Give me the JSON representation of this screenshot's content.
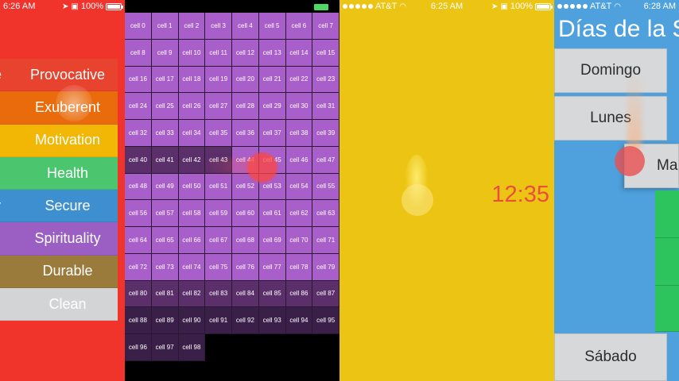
{
  "panel1": {
    "status": {
      "time": "6:26 AM",
      "battery": "100%"
    },
    "moods": [
      {
        "label": "Provocative",
        "color": "#e8432e",
        "clip": "e"
      },
      {
        "label": "Exuberent",
        "color": "#e96b0c",
        "clip": ""
      },
      {
        "label": "Motivation",
        "color": "#f2b705",
        "clip": ""
      },
      {
        "label": "Health",
        "color": "#4bc66f",
        "clip": ""
      },
      {
        "label": "Secure",
        "color": "#3d8fd0",
        "clip": "y"
      },
      {
        "label": "Spirituality",
        "color": "#9b5fc4",
        "clip": ""
      },
      {
        "label": "Durable",
        "color": "#9a7b3c",
        "clip": ""
      },
      {
        "label": "Clean",
        "color": "#d3d4d6",
        "clip": ""
      }
    ]
  },
  "panel2": {
    "cells": [
      "cell 0",
      "cell 1",
      "cell 2",
      "cell 3",
      "cell 4",
      "cell 5",
      "cell 6",
      "cell 7",
      "cell 8",
      "cell 9",
      "cell 10",
      "cell 11",
      "cell 12",
      "cell 13",
      "cell 14",
      "cell 15",
      "cell 16",
      "cell 17",
      "cell 18",
      "cell 19",
      "cell 20",
      "cell 21",
      "cell 22",
      "cell 23",
      "cell 24",
      "cell 25",
      "cell 26",
      "cell 27",
      "cell 28",
      "cell 29",
      "cell 30",
      "cell 31",
      "cell 32",
      "cell 33",
      "cell 34",
      "cell 35",
      "cell 36",
      "cell 37",
      "cell 38",
      "cell 39",
      "cell 40",
      "cell 41",
      "cell 42",
      "cell 43",
      "cell 44",
      "cell 45",
      "cell 46",
      "cell 47",
      "cell 48",
      "cell 49",
      "cell 50",
      "cell 51",
      "cell 52",
      "cell 53",
      "cell 54",
      "cell 55",
      "cell 56",
      "cell 57",
      "cell 58",
      "cell 59",
      "cell 60",
      "cell 61",
      "cell 62",
      "cell 63",
      "cell 64",
      "cell 65",
      "cell 66",
      "cell 67",
      "cell 68",
      "cell 69",
      "cell 70",
      "cell 71",
      "cell 72",
      "cell 73",
      "cell 74",
      "cell 75",
      "cell 76",
      "cell 77",
      "cell 78",
      "cell 79",
      "cell 80",
      "cell 81",
      "cell 82",
      "cell 83",
      "cell 84",
      "cell 85",
      "cell 86",
      "cell 87",
      "cell 88",
      "cell 89",
      "cell 90",
      "cell 91",
      "cell 92",
      "cell 93",
      "cell 94",
      "cell 95",
      "cell 96",
      "cell 97",
      "cell 98"
    ],
    "colors": {
      "light": "#a95fc9",
      "dark": "#5a2f6a",
      "darker": "#3a1f48",
      "border": "#2a1733"
    }
  },
  "panel3": {
    "status": {
      "carrier": "AT&T",
      "time": "6:25 AM",
      "battery": "100%"
    },
    "clock": "12:35"
  },
  "panel4": {
    "status": {
      "carrier": "AT&T",
      "time": "6:28 AM"
    },
    "title": "Días de la S",
    "days": {
      "sunday": "Domingo",
      "monday": "Lunes",
      "tuesday": "Ma",
      "saturday": "Sábado"
    }
  }
}
